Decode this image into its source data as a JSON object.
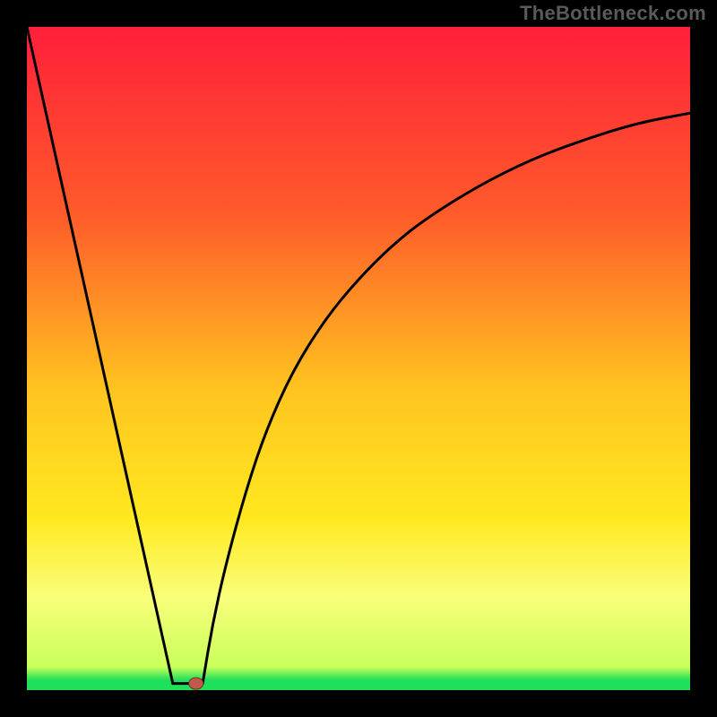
{
  "watermark": "TheBottleneck.com",
  "colors": {
    "bg_black": "#000000",
    "grad_top": "#ff1f3a",
    "grad_mid1": "#ff9a1f",
    "grad_mid2": "#ffe31f",
    "grad_band": "#f9ff7a",
    "grad_green": "#1fe05a",
    "curve": "#000000",
    "marker_fill": "#c05a4a",
    "marker_stroke": "#7a2f24"
  },
  "chart_data": {
    "type": "line",
    "title": "",
    "xlabel": "",
    "ylabel": "",
    "xlim": [
      0,
      100
    ],
    "ylim": [
      0,
      100
    ],
    "grid": false,
    "legend": false,
    "series": [
      {
        "name": "left-falling-segment",
        "x": [
          0,
          22
        ],
        "y": [
          100,
          1
        ]
      },
      {
        "name": "flat-bottom-segment",
        "x": [
          22,
          26.5
        ],
        "y": [
          1,
          1
        ]
      },
      {
        "name": "right-rising-curve",
        "x": [
          26.5,
          28,
          30,
          33,
          36,
          40,
          45,
          50,
          55,
          60,
          68,
          76,
          84,
          92,
          100
        ],
        "y": [
          1,
          10,
          19,
          30,
          39,
          48,
          56,
          62,
          67,
          71,
          76,
          80,
          83,
          85.5,
          87
        ]
      }
    ],
    "markers": [
      {
        "name": "min-point",
        "x": 25.5,
        "y": 1
      }
    ],
    "background_gradient_stops": [
      {
        "pos": 0.0,
        "color": "#ff1f3a"
      },
      {
        "pos": 0.28,
        "color": "#ff5a2a"
      },
      {
        "pos": 0.55,
        "color": "#ffc51f"
      },
      {
        "pos": 0.74,
        "color": "#ffe81f"
      },
      {
        "pos": 0.86,
        "color": "#f9ff7a"
      },
      {
        "pos": 0.965,
        "color": "#c8ff5a"
      },
      {
        "pos": 0.985,
        "color": "#1fe05a"
      },
      {
        "pos": 1.0,
        "color": "#1fe05a"
      }
    ]
  }
}
